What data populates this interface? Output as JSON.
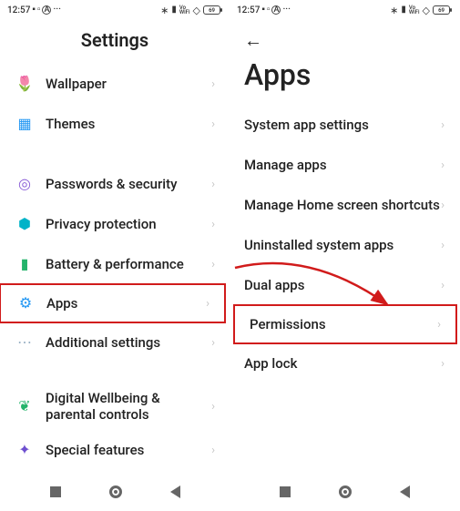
{
  "status": {
    "time": "12:57",
    "carrier_glyph": "■",
    "sim_glyph": "▣",
    "a_glyph": "A",
    "more": "···",
    "bt_glyph": "⋮",
    "signal_glyph": "▮",
    "vowifi": "Vo\nWiFi",
    "wifi_glyph": "⋰",
    "battery_text": "69"
  },
  "left": {
    "title": "Settings",
    "rows": [
      {
        "icon": "🌷",
        "iconClass": "i-rose",
        "name": "wallpaper",
        "label": "Wallpaper"
      },
      {
        "icon": "▦",
        "iconClass": "i-blue",
        "name": "themes",
        "label": "Themes"
      }
    ],
    "rows2": [
      {
        "icon": "◎",
        "iconClass": "i-purple",
        "name": "passwords-security",
        "label": "Passwords & security"
      },
      {
        "icon": "⬢",
        "iconClass": "i-teal",
        "name": "privacy-protection",
        "label": "Privacy protection"
      },
      {
        "icon": "▮",
        "iconClass": "i-green",
        "name": "battery-performance",
        "label": "Battery & performance"
      },
      {
        "icon": "⚙",
        "iconClass": "i-blue",
        "name": "apps",
        "label": "Apps",
        "highlight": true
      },
      {
        "icon": "⋯",
        "iconClass": "i-greyblue",
        "name": "additional-settings",
        "label": "Additional settings"
      }
    ],
    "rows3": [
      {
        "icon": "❦",
        "iconClass": "i-green",
        "name": "digital-wellbeing",
        "label": "Digital Wellbeing & parental controls",
        "multi": true
      },
      {
        "icon": "✦",
        "iconClass": "i-darkpurple",
        "name": "special-features",
        "label": "Special features"
      }
    ]
  },
  "right": {
    "title": "Apps",
    "rows": [
      {
        "name": "system-app-settings",
        "label": "System app settings"
      },
      {
        "name": "manage-apps",
        "label": "Manage apps"
      },
      {
        "name": "manage-home-shortcuts",
        "label": "Manage Home screen shortcuts",
        "multi": true
      },
      {
        "name": "uninstalled-system-apps",
        "label": "Uninstalled system apps"
      },
      {
        "name": "dual-apps",
        "label": "Dual apps"
      },
      {
        "name": "permissions",
        "label": "Permissions",
        "highlight": true
      },
      {
        "name": "app-lock",
        "label": "App lock"
      }
    ]
  }
}
